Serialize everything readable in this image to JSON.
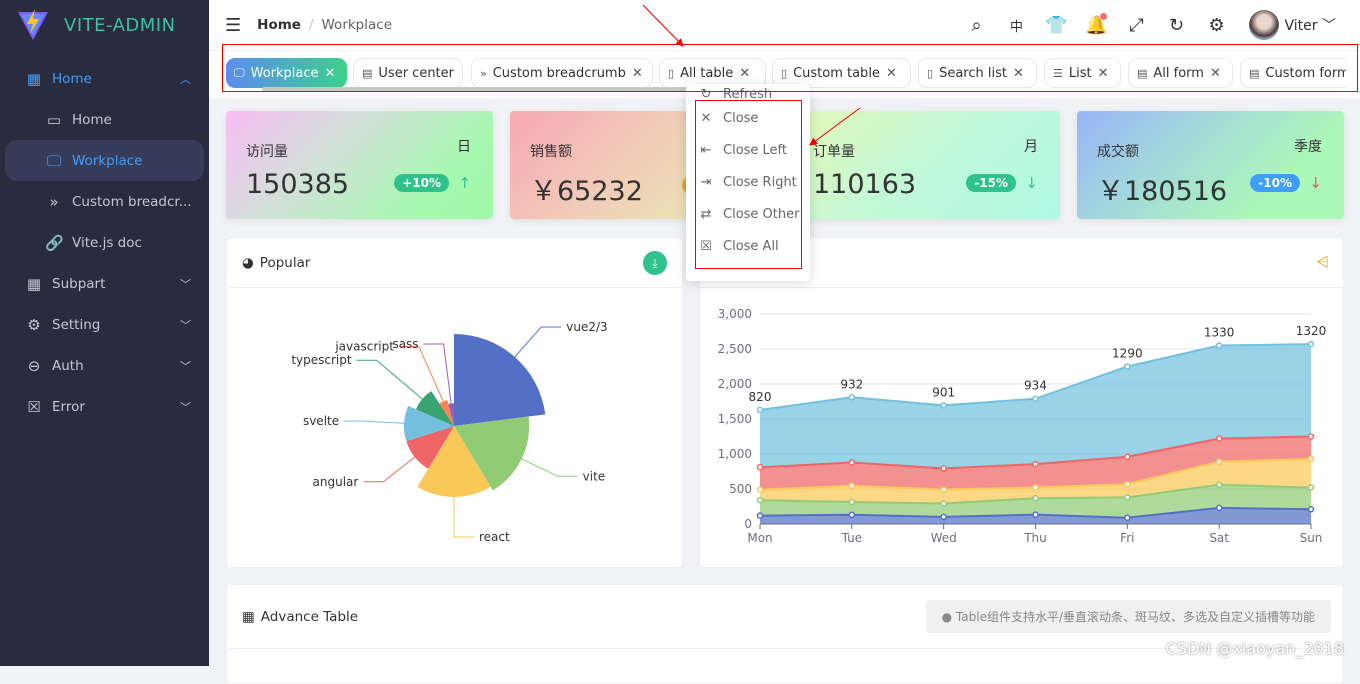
{
  "app": {
    "title": "VITE-ADMIN"
  },
  "sidebar": {
    "items": [
      {
        "label": "Home",
        "icon": "windows-icon",
        "expanded": true
      },
      {
        "label": "Home",
        "icon": "laptop-icon"
      },
      {
        "label": "Workplace",
        "icon": "monitor-icon",
        "selected": true
      },
      {
        "label": "Custom breadcr...",
        "icon": "double-chevron-icon"
      },
      {
        "label": "Vite.js doc",
        "icon": "link-icon"
      },
      {
        "label": "Subpart",
        "icon": "grid-icon"
      },
      {
        "label": "Setting",
        "icon": "gear-icon"
      },
      {
        "label": "Auth",
        "icon": "minus-circle-icon"
      },
      {
        "label": "Error",
        "icon": "error-icon"
      }
    ]
  },
  "header": {
    "breadcrumb": [
      "Home",
      "Workplace"
    ],
    "user": "Viter",
    "icons": [
      "search-icon",
      "language-icon",
      "tshirt-icon",
      "bell-icon",
      "fullscreen-icon",
      "refresh-icon",
      "gear-icon"
    ]
  },
  "tabs": [
    {
      "label": "Workplace",
      "active": true
    },
    {
      "label": "User center"
    },
    {
      "label": "Custom breadcrumb"
    },
    {
      "label": "All table"
    },
    {
      "label": "Custom table"
    },
    {
      "label": "Search list"
    },
    {
      "label": "List"
    },
    {
      "label": "All form"
    },
    {
      "label": "Custom form"
    }
  ],
  "context_menu": [
    "Refresh",
    "Close",
    "Close Left",
    "Close Right",
    "Close Other",
    "Close All"
  ],
  "cards": [
    {
      "title": "访问量",
      "period": "日",
      "value": "150385",
      "badge": "+10%",
      "badge_color": "#2fc28a",
      "trend": "up"
    },
    {
      "title": "销售额",
      "period": "",
      "value": "￥65232",
      "badge": "",
      "badge_color": "#e6a23c",
      "trend": ""
    },
    {
      "title": "订单量",
      "period": "月",
      "value": "110163",
      "badge": "-15%",
      "badge_color": "#2fc28a",
      "trend": "down"
    },
    {
      "title": "成交额",
      "period": "季度",
      "value": "￥180516",
      "badge": "-10%",
      "badge_color": "#409eff",
      "trend": "down"
    }
  ],
  "popular": {
    "title": "Popular"
  },
  "table_panel": {
    "title": "Advance Table",
    "notice": "Table组件支持水平/垂直滚动条、斑马纹、多选及自定义插槽等功能"
  },
  "watermark": "CSDN @xiaoyan_2018",
  "chart_data": [
    {
      "type": "pie",
      "rose": "radius",
      "categories": [
        "vue2/3",
        "vite",
        "react",
        "angular",
        "svelte",
        "typescript",
        "javascript",
        "sass"
      ],
      "values": [
        40,
        32,
        30,
        20,
        20,
        16,
        9,
        7
      ],
      "colors": [
        "#5470c6",
        "#91cc75",
        "#fac858",
        "#ee6666",
        "#73c0de",
        "#3ba272",
        "#fc8452",
        "#9a60b4"
      ]
    },
    {
      "type": "area",
      "stacked": true,
      "categories": [
        "Mon",
        "Tue",
        "Wed",
        "Thu",
        "Fri",
        "Sat",
        "Sun"
      ],
      "ylim": [
        0,
        3000
      ],
      "yticks": [
        "0",
        "500",
        "1,000",
        "1,500",
        "2,000",
        "2,500",
        "3,000"
      ],
      "grid": true,
      "series": [
        {
          "values": [
            120,
            132,
            101,
            134,
            90,
            230,
            210
          ],
          "color": "#5470c6"
        },
        {
          "values": [
            220,
            182,
            191,
            234,
            290,
            330,
            310
          ],
          "color": "#91cc75"
        },
        {
          "values": [
            150,
            232,
            201,
            154,
            190,
            330,
            410
          ],
          "color": "#fac858"
        },
        {
          "values": [
            320,
            332,
            301,
            334,
            390,
            330,
            320
          ],
          "color": "#ee6666"
        },
        {
          "values": [
            820,
            932,
            901,
            934,
            1290,
            1330,
            1320
          ],
          "color": "#73c0de",
          "labels": true
        }
      ]
    }
  ]
}
